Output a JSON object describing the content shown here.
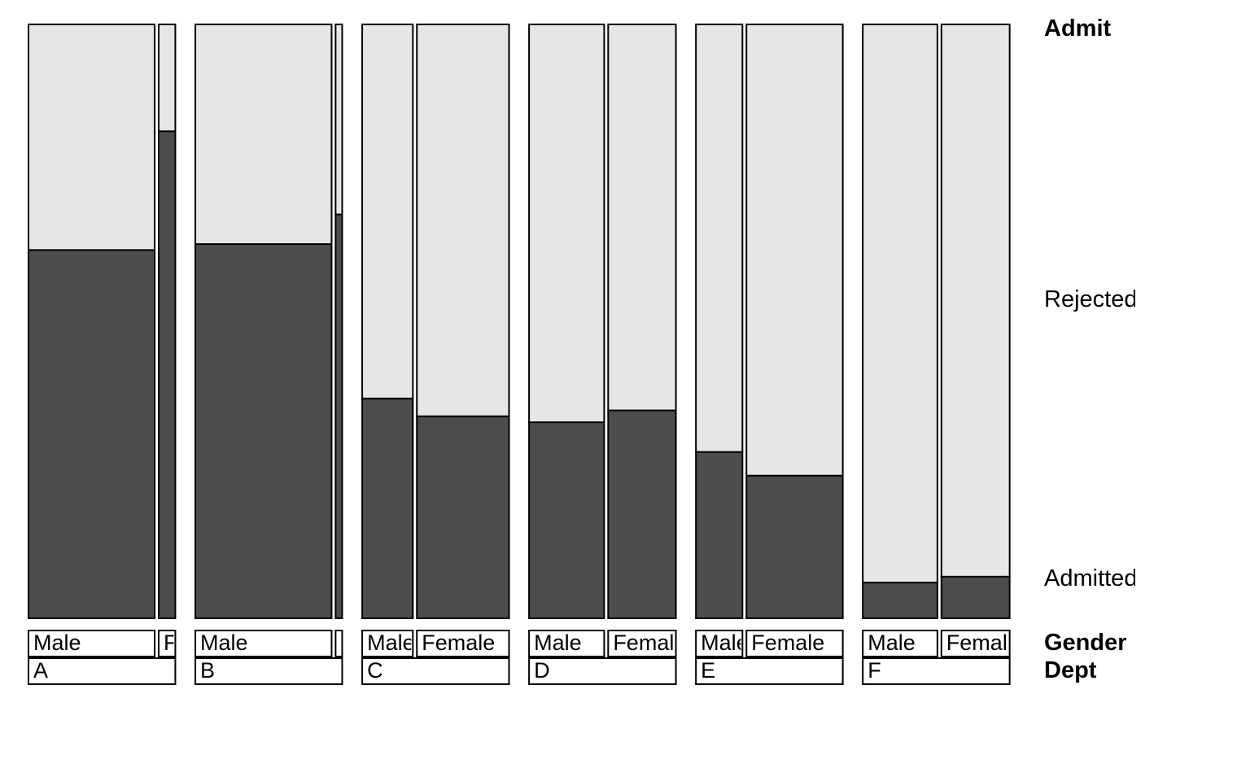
{
  "chart_data": {
    "type": "bar",
    "title": "",
    "xlabel": "Dept",
    "ylabel": "",
    "ylim": [
      0,
      1
    ],
    "axis_labels": {
      "top_right": "Admit",
      "right_upper": "Rejected",
      "right_lower": "Admitted",
      "bottom_right_row1": "Gender",
      "bottom_right_row2": "Dept"
    },
    "depts": [
      "A",
      "B",
      "C",
      "D",
      "E",
      "F"
    ],
    "genders": [
      "Male",
      "Female"
    ],
    "gender_label_short": {
      "Male": "Male",
      "Female": "Female"
    },
    "series": [
      {
        "dept": "A",
        "cells": [
          {
            "gender": "Male",
            "weight": 0.182,
            "admitted_frac": 0.62
          },
          {
            "gender": "Female",
            "weight": 0.024,
            "admitted_frac": 0.82
          }
        ]
      },
      {
        "dept": "B",
        "cells": [
          {
            "gender": "Male",
            "weight": 0.124,
            "admitted_frac": 0.63
          },
          {
            "gender": "Female",
            "weight": 0.006,
            "admitted_frac": 0.68
          }
        ]
      },
      {
        "dept": "C",
        "cells": [
          {
            "gender": "Male",
            "weight": 0.072,
            "admitted_frac": 0.37
          },
          {
            "gender": "Female",
            "weight": 0.131,
            "admitted_frac": 0.34
          }
        ]
      },
      {
        "dept": "D",
        "cells": [
          {
            "gender": "Male",
            "weight": 0.092,
            "admitted_frac": 0.33
          },
          {
            "gender": "Female",
            "weight": 0.083,
            "admitted_frac": 0.35
          }
        ]
      },
      {
        "dept": "E",
        "cells": [
          {
            "gender": "Male",
            "weight": 0.042,
            "admitted_frac": 0.28
          },
          {
            "gender": "Female",
            "weight": 0.087,
            "admitted_frac": 0.24
          }
        ]
      },
      {
        "dept": "F",
        "cells": [
          {
            "gender": "Male",
            "weight": 0.082,
            "admitted_frac": 0.06
          },
          {
            "gender": "Female",
            "weight": 0.075,
            "admitted_frac": 0.07
          }
        ]
      }
    ],
    "colors": {
      "admitted": "#4d4d4d",
      "rejected": "#e6e6e6",
      "stroke": "#000000",
      "label_box_fill": "#ffffff"
    },
    "layout": {
      "dept_gap": 0.02,
      "gender_gap": 0.004,
      "band_w": 0.1467
    }
  }
}
